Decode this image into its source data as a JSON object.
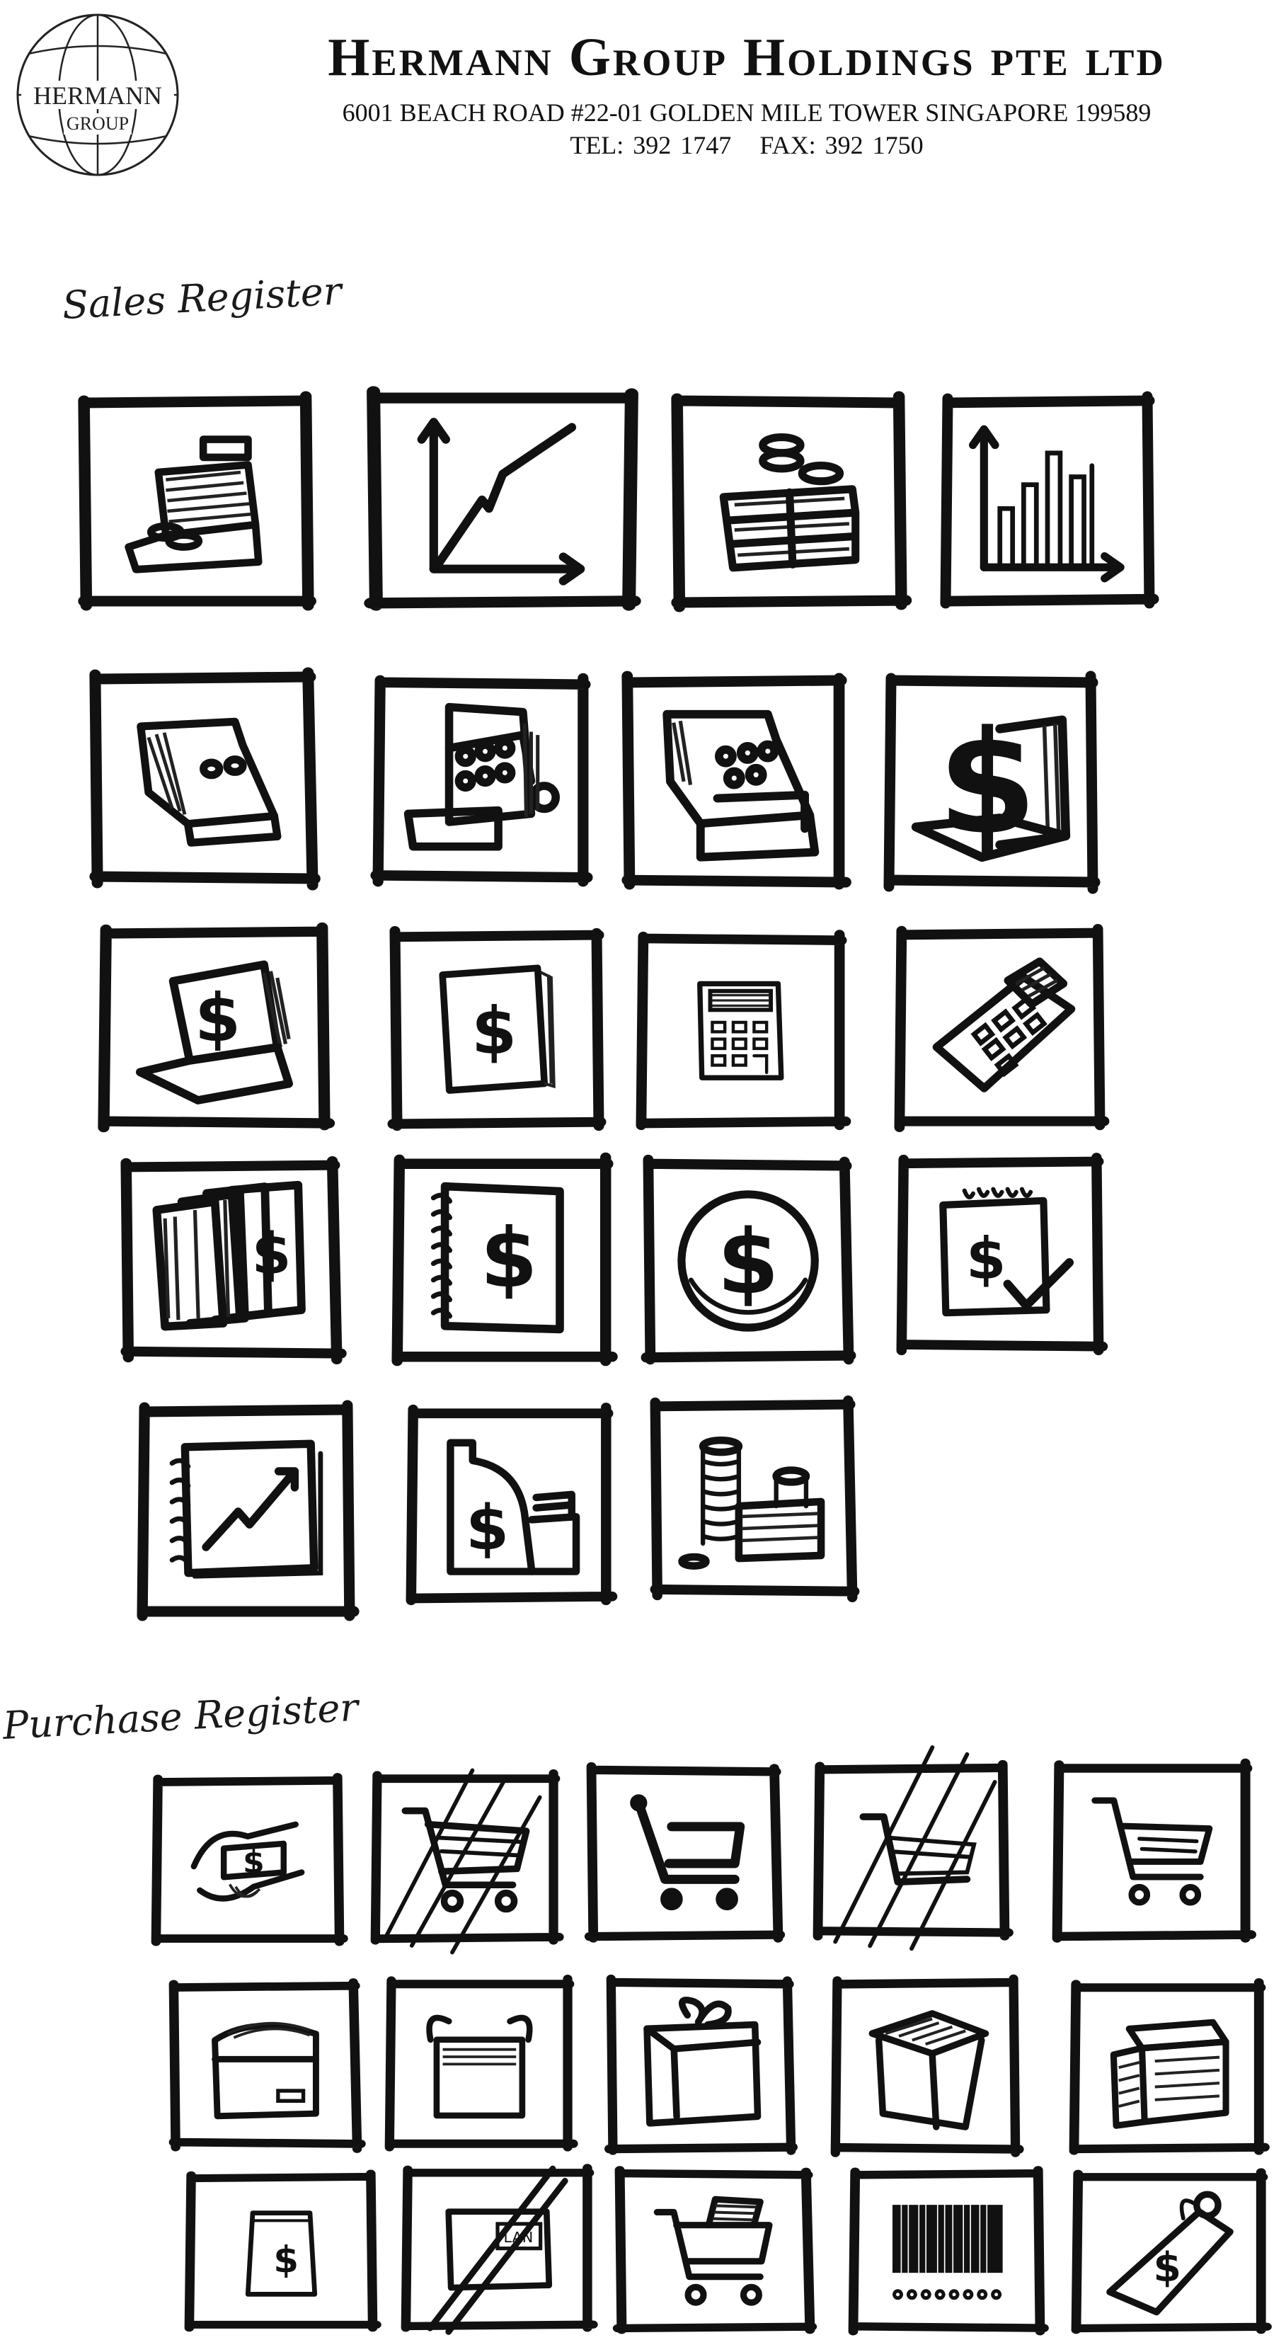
{
  "letterhead": {
    "logo_line1": "HERMANN",
    "logo_line2": "GROUP",
    "company_name": "Hermann Group Holdings pte ltd",
    "address": "6001 BEACH ROAD #22-01 GOLDEN MILE TOWER SINGAPORE 199589",
    "tel": "TEL: 392 1747",
    "fax": "FAX: 392 1750"
  },
  "sections": [
    {
      "label": "Sales Register"
    },
    {
      "label": "Purchase Register"
    }
  ],
  "icon_glyphs": {
    "dollar": "$",
    "label_text": "LAN"
  },
  "sales_icons": [
    "cash-register-coins-icon",
    "line-graph-icon",
    "coins-cash-stack-icon",
    "bar-chart-icon",
    "cash-register-icon",
    "cash-register-keys-icon",
    "cash-register-drawer-icon",
    "cash-register-dollar-icon",
    "cash-register-dollar-screen-icon",
    "dollar-ledger-icon",
    "calculator-upright-icon",
    "calculator-angled-icon",
    "books-dollar-icon",
    "dollar-notebook-icon",
    "dollar-coin-icon",
    "dollar-notepad-check-icon",
    "growth-chart-notebook-icon",
    "register-dollar-cash-icon",
    "coins-stacks-icon"
  ],
  "purchase_icons": [
    "hands-paying-icon",
    "shopping-cart-crossed-icon",
    "shopping-cart-icon",
    "cart-sketch-crossed-icon",
    "shopping-cart-right-icon",
    "wallet-icon",
    "basket-icon",
    "package-bow-icon",
    "open-box-icon",
    "parcel-icon",
    "dollar-bag-icon",
    "crossed-label-icon",
    "full-cart-icon",
    "barcode-icon",
    "price-tag-icon"
  ]
}
